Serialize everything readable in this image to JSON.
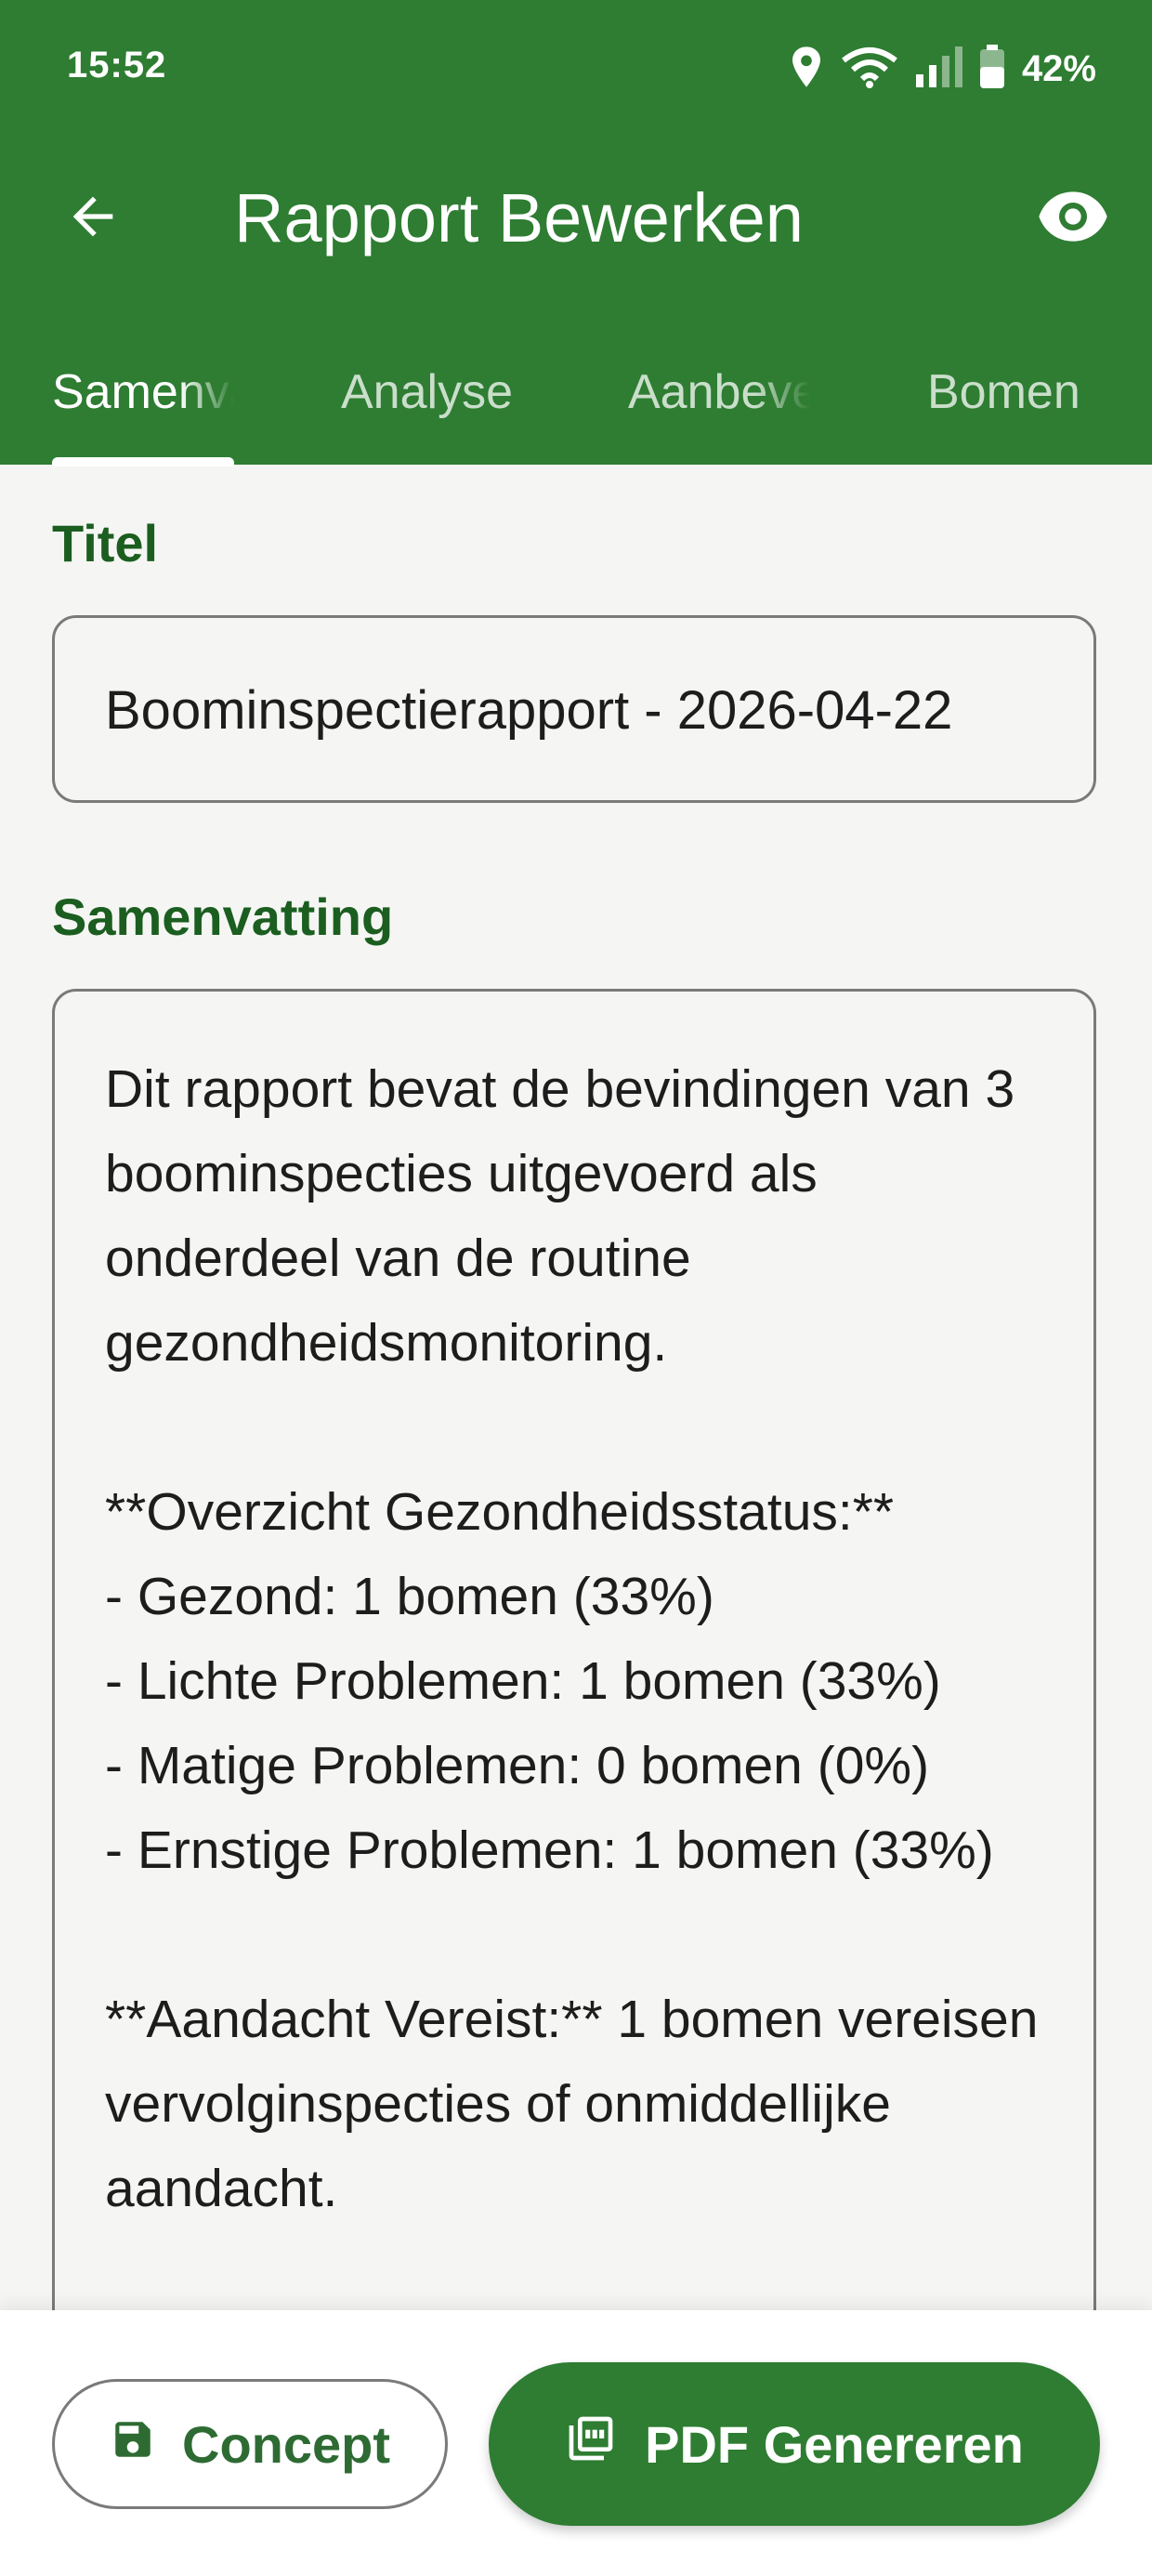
{
  "status_bar": {
    "time": "15:52",
    "battery": "42%"
  },
  "app_bar": {
    "title": "Rapport Bewerken"
  },
  "tabs": [
    {
      "label": "Samenvatting",
      "active": true
    },
    {
      "label": "Analyse",
      "active": false
    },
    {
      "label": "Aanbevelingen",
      "active": false
    },
    {
      "label": "Bomen",
      "active": false
    }
  ],
  "form": {
    "title_label": "Titel",
    "title_value": "Boominspectierapport - 2026-04-22",
    "summary_label": "Samenvatting",
    "summary_value": "Dit rapport bevat de bevindingen van 3 boominspecties uitgevoerd als onderdeel van de routine gezondheidsmonitoring.\n\n**Overzicht Gezondheidsstatus:**\n- Gezond: 1 bomen (33%)\n- Lichte Problemen: 1 bomen (33%)\n- Matige Problemen: 0 bomen (0%)\n- Ernstige Problemen: 1 bomen (33%)\n\n**Aandacht Vereist:** 1 bomen vereisen vervolginspecties of onmiddellijke aandacht."
  },
  "actions": {
    "draft_label": "Concept",
    "pdf_label": "PDF Genereren"
  },
  "colors": {
    "primary": "#2e7d32",
    "label_green": "#1b5e20",
    "background": "#f5f6f3"
  },
  "icons": [
    "location-icon",
    "wifi-icon",
    "signal-icon",
    "battery-icon",
    "back-arrow-icon",
    "eye-icon",
    "save-icon",
    "pdf-icon"
  ]
}
